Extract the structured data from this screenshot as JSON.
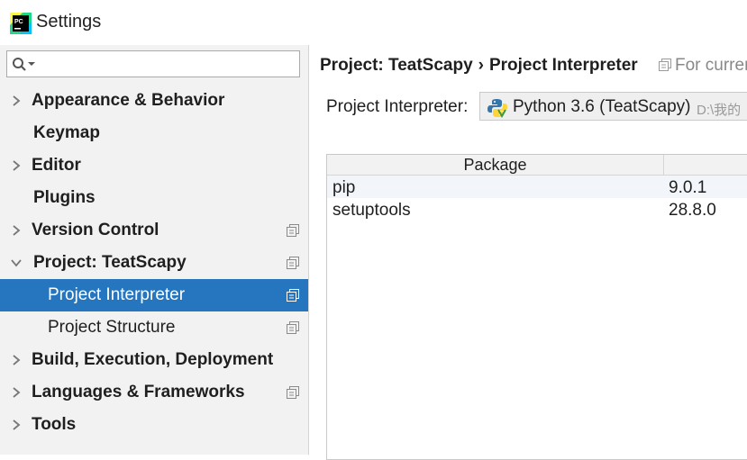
{
  "window": {
    "title": "Settings"
  },
  "search": {
    "value": "",
    "placeholder": ""
  },
  "sidebar": {
    "items": [
      {
        "label": "Appearance & Behavior",
        "expandable": true,
        "expanded": false,
        "bold": true,
        "copy_icon": false,
        "indent": 0
      },
      {
        "label": "Keymap",
        "expandable": false,
        "bold": true,
        "copy_icon": false,
        "indent": 0
      },
      {
        "label": "Editor",
        "expandable": true,
        "expanded": false,
        "bold": true,
        "copy_icon": false,
        "indent": 0
      },
      {
        "label": "Plugins",
        "expandable": false,
        "bold": true,
        "copy_icon": false,
        "indent": 0
      },
      {
        "label": "Version Control",
        "expandable": true,
        "expanded": false,
        "bold": true,
        "copy_icon": true,
        "indent": 0
      },
      {
        "label": "Project: TeatScapy",
        "expandable": true,
        "expanded": true,
        "bold": true,
        "copy_icon": true,
        "indent": 0
      },
      {
        "label": "Project Interpreter",
        "expandable": false,
        "bold": false,
        "copy_icon": true,
        "indent": 1,
        "selected": true
      },
      {
        "label": "Project Structure",
        "expandable": false,
        "bold": false,
        "copy_icon": true,
        "indent": 1
      },
      {
        "label": "Build, Execution, Deployment",
        "expandable": true,
        "expanded": false,
        "bold": true,
        "copy_icon": false,
        "indent": 0
      },
      {
        "label": "Languages & Frameworks",
        "expandable": true,
        "expanded": false,
        "bold": true,
        "copy_icon": true,
        "indent": 0
      },
      {
        "label": "Tools",
        "expandable": true,
        "expanded": false,
        "bold": true,
        "copy_icon": false,
        "indent": 0
      }
    ]
  },
  "main": {
    "breadcrumb": [
      "Project: TeatScapy",
      "Project Interpreter"
    ],
    "for_current": "For curren",
    "interpreter_label": "Project Interpreter:",
    "interpreter_name": "Python 3.6 (TeatScapy)",
    "interpreter_path": "D:\\我的",
    "table": {
      "headers": [
        "Package",
        ""
      ],
      "rows": [
        {
          "name": "pip",
          "version": "9.0.1"
        },
        {
          "name": "setuptools",
          "version": "28.8.0"
        }
      ]
    }
  },
  "colors": {
    "accent": "#2675bf",
    "sidebar_bg": "#f2f2f2"
  }
}
